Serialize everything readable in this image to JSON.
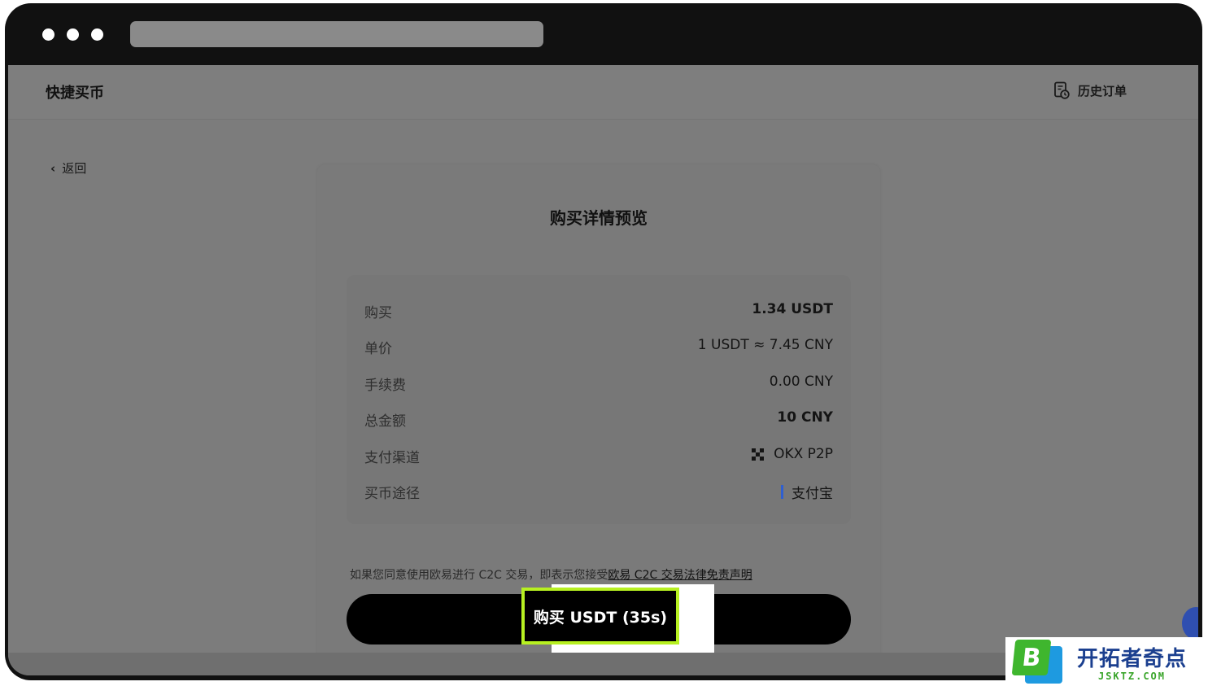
{
  "header": {
    "brand": "快捷买币",
    "history_label": "历史订单"
  },
  "nav": {
    "back_label": "返回"
  },
  "card": {
    "title": "购买详情预览",
    "rows": [
      {
        "label": "购买",
        "value": "1.34 USDT"
      },
      {
        "label": "单价",
        "value": "1 USDT ≈ 7.45 CNY"
      },
      {
        "label": "手续费",
        "value": "0.00 CNY"
      },
      {
        "label": "总金额",
        "value": "10 CNY"
      },
      {
        "label": "支付渠道",
        "value": "OKX P2P"
      },
      {
        "label": "买币途径",
        "value": "支付宝"
      }
    ],
    "disclaimer_text": "如果您同意使用欧易进行 C2C 交易，即表示您接受",
    "disclaimer_link": "欧易 C2C 交易法律免责声明",
    "buy_button_label": "购买 USDT (35s)"
  },
  "watermark": {
    "logo_letter": "B",
    "name": "开拓者奇点",
    "url": "JSKTZ.COM"
  },
  "colors": {
    "highlight": "#b7f021",
    "button": "#000000",
    "accent_bar": "#2f5fd0"
  }
}
